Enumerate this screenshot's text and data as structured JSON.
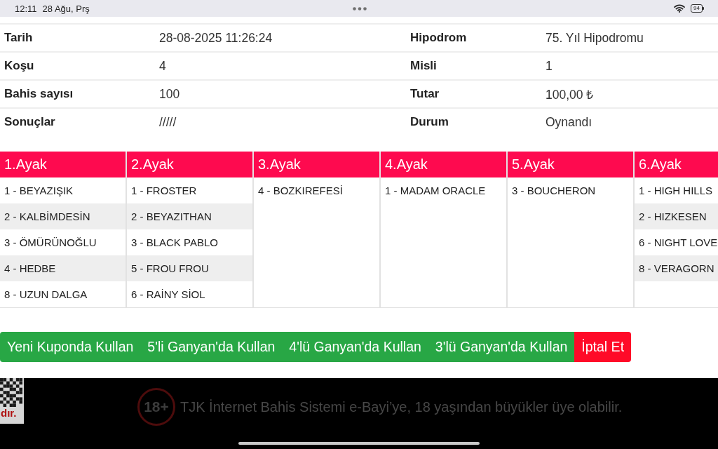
{
  "status_bar": {
    "time": "12:11",
    "date": "28 Ağu, Prş",
    "battery": "94"
  },
  "details": [
    {
      "left": {
        "label": "Tarih",
        "value": "28-08-2025 11:26:24"
      },
      "right": {
        "label": "Hipodrom",
        "value": "75. Yıl Hipodromu"
      }
    },
    {
      "left": {
        "label": "Koşu",
        "value": "4"
      },
      "right": {
        "label": "Misli",
        "value": "1"
      }
    },
    {
      "left": {
        "label": "Bahis sayısı",
        "value": "100"
      },
      "right": {
        "label": "Tutar",
        "value": "100,00 ₺"
      }
    },
    {
      "left": {
        "label": "Sonuçlar",
        "value": "/////"
      },
      "right": {
        "label": "Durum",
        "value": "Oynandı"
      }
    }
  ],
  "legs": [
    {
      "title": "1.Ayak",
      "horses": [
        "1 - BEYAZIŞIK",
        "2 - KALBİMDESİN",
        "3 - ÖMÜRÜNOĞLU",
        "4 - HEDBE",
        "8 - UZUN DALGA"
      ]
    },
    {
      "title": "2.Ayak",
      "horses": [
        "1 - FROSTER",
        "2 - BEYAZITHAN",
        "3 - BLACK PABLO",
        "5 - FROU FROU",
        "6 - RAİNY SİOL"
      ]
    },
    {
      "title": "3.Ayak",
      "horses": [
        "4 - BOZKIREFESİ"
      ]
    },
    {
      "title": "4.Ayak",
      "horses": [
        "1 - MADAM ORACLE"
      ]
    },
    {
      "title": "5.Ayak",
      "horses": [
        "3 - BOUCHERON"
      ]
    },
    {
      "title": "6.Ayak",
      "horses": [
        "1 - HIGH HILLS",
        "2 - HIZKESEN",
        "6 - NIGHT LOVE",
        "8 - VERAGORN"
      ]
    }
  ],
  "actions": [
    {
      "label": "Yeni Kuponda Kullan",
      "kind": "primary"
    },
    {
      "label": "5'li Ganyan'da Kullan",
      "kind": "primary"
    },
    {
      "label": "4'lü Ganyan'da Kullan",
      "kind": "primary"
    },
    {
      "label": "3'lü Ganyan'da Kullan",
      "kind": "primary"
    },
    {
      "label": "İptal Et",
      "kind": "danger"
    }
  ],
  "footer": {
    "qr_caption": "dır.",
    "age_badge": "18+",
    "notice": "TJK İnternet Bahis Sistemi e-Bayi’ye, 18 yaşından büyükler üye olabilir."
  }
}
